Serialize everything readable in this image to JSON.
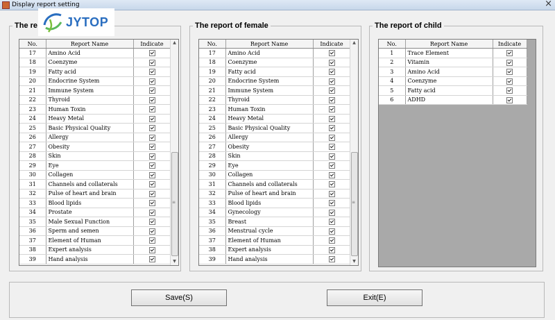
{
  "window": {
    "title": "Display report setting",
    "close_glyph": "×"
  },
  "logo": {
    "text": "JYTOP"
  },
  "columns": {
    "no": "No.",
    "name": "Report Name",
    "indicate": "Indicate"
  },
  "male": {
    "title": "The report of male",
    "visible_title": "The re",
    "rows": [
      {
        "no": "17",
        "name": "Amino Acid",
        "checked": true
      },
      {
        "no": "18",
        "name": "Coenzyme",
        "checked": true
      },
      {
        "no": "19",
        "name": "Fatty acid",
        "checked": true
      },
      {
        "no": "20",
        "name": "Endocrine System",
        "checked": true
      },
      {
        "no": "21",
        "name": "Immune System",
        "checked": true
      },
      {
        "no": "22",
        "name": "Thyroid",
        "checked": true
      },
      {
        "no": "23",
        "name": "Human Toxin",
        "checked": true
      },
      {
        "no": "24",
        "name": "Heavy Metal",
        "checked": true
      },
      {
        "no": "25",
        "name": "Basic Physical Quality",
        "checked": true
      },
      {
        "no": "26",
        "name": "Allergy",
        "checked": true
      },
      {
        "no": "27",
        "name": "Obesity",
        "checked": true
      },
      {
        "no": "28",
        "name": "Skin",
        "checked": true
      },
      {
        "no": "29",
        "name": "Eye",
        "checked": true
      },
      {
        "no": "30",
        "name": "Collagen",
        "checked": true
      },
      {
        "no": "31",
        "name": "Channels and collaterals",
        "checked": true
      },
      {
        "no": "32",
        "name": "Pulse of heart and brain",
        "checked": true
      },
      {
        "no": "33",
        "name": "Blood lipids",
        "checked": true
      },
      {
        "no": "34",
        "name": "Prostate",
        "checked": true
      },
      {
        "no": "35",
        "name": "Male Sexual Function",
        "checked": true
      },
      {
        "no": "36",
        "name": "Sperm and semen",
        "checked": true
      },
      {
        "no": "37",
        "name": "Element of Human",
        "checked": true
      },
      {
        "no": "38",
        "name": "Expert analysis",
        "checked": true
      },
      {
        "no": "39",
        "name": "Hand analysis",
        "checked": true
      }
    ]
  },
  "female": {
    "title": "The report of female",
    "rows": [
      {
        "no": "17",
        "name": "Amino Acid",
        "checked": true
      },
      {
        "no": "18",
        "name": "Coenzyme",
        "checked": true
      },
      {
        "no": "19",
        "name": "Fatty acid",
        "checked": true
      },
      {
        "no": "20",
        "name": "Endocrine System",
        "checked": true
      },
      {
        "no": "21",
        "name": "Immune System",
        "checked": true
      },
      {
        "no": "22",
        "name": "Thyroid",
        "checked": true
      },
      {
        "no": "23",
        "name": "Human Toxin",
        "checked": true
      },
      {
        "no": "24",
        "name": "Heavy Metal",
        "checked": true
      },
      {
        "no": "25",
        "name": "Basic Physical Quality",
        "checked": true
      },
      {
        "no": "26",
        "name": "Allergy",
        "checked": true
      },
      {
        "no": "27",
        "name": "Obesity",
        "checked": true
      },
      {
        "no": "28",
        "name": "Skin",
        "checked": true
      },
      {
        "no": "29",
        "name": "Eye",
        "checked": true
      },
      {
        "no": "30",
        "name": "Collagen",
        "checked": true
      },
      {
        "no": "31",
        "name": "Channels and collaterals",
        "checked": true
      },
      {
        "no": "32",
        "name": "Pulse of heart and brain",
        "checked": true
      },
      {
        "no": "33",
        "name": "Blood lipids",
        "checked": true
      },
      {
        "no": "34",
        "name": "Gynecology",
        "checked": true
      },
      {
        "no": "35",
        "name": "Breast",
        "checked": true
      },
      {
        "no": "36",
        "name": "Menstrual cycle",
        "checked": true
      },
      {
        "no": "37",
        "name": "Element of Human",
        "checked": true
      },
      {
        "no": "38",
        "name": "Expert analysis",
        "checked": true
      },
      {
        "no": "39",
        "name": "Hand analysis",
        "checked": true
      }
    ]
  },
  "child": {
    "title": "The report of child",
    "rows": [
      {
        "no": "1",
        "name": "Trace Element",
        "checked": true
      },
      {
        "no": "2",
        "name": "Vitamin",
        "checked": true
      },
      {
        "no": "3",
        "name": "Amino Acid",
        "checked": true
      },
      {
        "no": "4",
        "name": "Coenzyme",
        "checked": true
      },
      {
        "no": "5",
        "name": "Fatty acid",
        "checked": true
      },
      {
        "no": "6",
        "name": "ADHD",
        "checked": true
      }
    ]
  },
  "buttons": {
    "save": "Save(S)",
    "exit": "Exit(E)"
  },
  "colors": {
    "accent": "#2a6ec0",
    "grid_empty": "#a9a9a9"
  },
  "icons": {
    "close": "close-icon",
    "logo": "logo-icon",
    "checkbox": "checkbox-checked-icon"
  }
}
